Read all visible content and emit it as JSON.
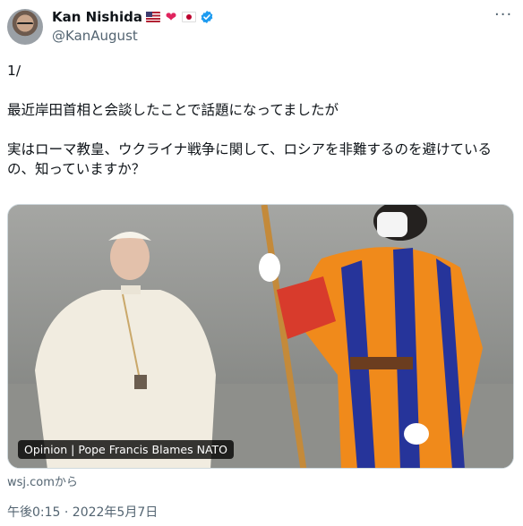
{
  "author": {
    "display_name": "Kan Nishida",
    "handle": "@KanAugust",
    "badges": [
      "us-flag-icon",
      "red-heart-icon",
      "japan-flag-icon",
      "verified-badge-icon"
    ],
    "heart_glyph": "❤"
  },
  "more_button": "···",
  "tweet": {
    "text": "1/\n\n最近岸田首相と会談したことで話題になってましたが\n\n実はローマ教皇、ウクライナ戦争に関して、ロシアを非難するのを避けているの、知っていますか？"
  },
  "media": {
    "caption": "Opinion | Pope Francis Blames NATO",
    "source": "wsj.comから"
  },
  "timestamp": "午後0:15 · 2022年5月7日",
  "colors": {
    "verified": "#1d9bf0",
    "secondary_text": "#536471",
    "primary_text": "#0f1419"
  }
}
